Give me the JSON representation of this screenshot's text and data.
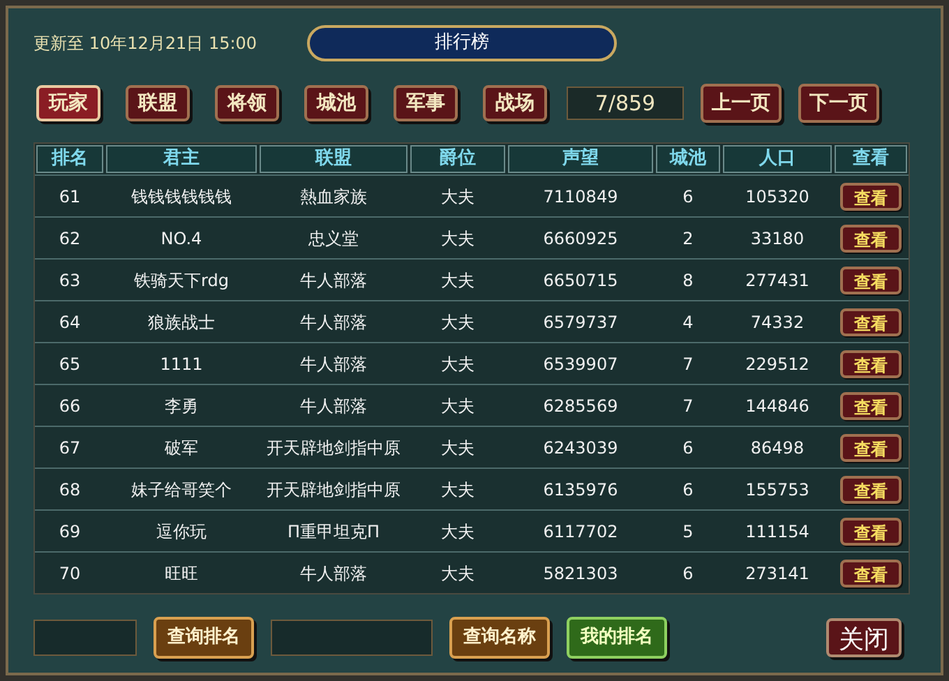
{
  "updated": "更新至 10年12月21日 15:00",
  "title": "排行榜",
  "tabs": [
    {
      "label": "玩家",
      "selected": true
    },
    {
      "label": "联盟",
      "selected": false
    },
    {
      "label": "将领",
      "selected": false
    },
    {
      "label": "城池",
      "selected": false
    },
    {
      "label": "军事",
      "selected": false
    },
    {
      "label": "战场",
      "selected": false
    }
  ],
  "page_indicator": "7/859",
  "nav_buttons": [
    "上一页",
    "下一页"
  ],
  "table": {
    "columns": [
      "排名",
      "君主",
      "联盟",
      "爵位",
      "声望",
      "城池",
      "人口",
      "查看"
    ],
    "rows": [
      {
        "cells": [
          "61",
          "钱钱钱钱钱钱",
          "熱血家族",
          "大夫",
          "7110849",
          "6",
          "105320"
        ],
        "action": "查看"
      },
      {
        "cells": [
          "62",
          "NO.4",
          "忠义堂",
          "大夫",
          "6660925",
          "2",
          "33180"
        ],
        "action": "查看"
      },
      {
        "cells": [
          "63",
          "铁骑天下rdg",
          "牛人部落",
          "大夫",
          "6650715",
          "8",
          "277431"
        ],
        "action": "查看"
      },
      {
        "cells": [
          "64",
          "狼族战士",
          "牛人部落",
          "大夫",
          "6579737",
          "4",
          "74332"
        ],
        "action": "查看"
      },
      {
        "cells": [
          "65",
          "1111",
          "牛人部落",
          "大夫",
          "6539907",
          "7",
          "229512"
        ],
        "action": "查看"
      },
      {
        "cells": [
          "66",
          "李勇",
          "牛人部落",
          "大夫",
          "6285569",
          "7",
          "144846"
        ],
        "action": "查看"
      },
      {
        "cells": [
          "67",
          "破军",
          "开天辟地剑指中原",
          "大夫",
          "6243039",
          "6",
          "86498"
        ],
        "action": "查看"
      },
      {
        "cells": [
          "68",
          "妹子给哥笑个",
          "开天辟地剑指中原",
          "大夫",
          "6135976",
          "6",
          "155753"
        ],
        "action": "查看"
      },
      {
        "cells": [
          "69",
          "逗你玩",
          "Π重甲坦克Π",
          "大夫",
          "6117702",
          "5",
          "111154"
        ],
        "action": "查看"
      },
      {
        "cells": [
          "70",
          "旺旺",
          "牛人部落",
          "大夫",
          "5821303",
          "6",
          "273141"
        ],
        "action": "查看"
      }
    ]
  },
  "bottom": [
    {
      "kind": "field"
    },
    {
      "kind": "gold",
      "label": "查询排名"
    },
    {
      "kind": "field"
    },
    {
      "kind": "gold",
      "label": "查询名称"
    },
    {
      "kind": "green",
      "label": "我的排名"
    },
    {
      "kind": "close",
      "label": "关闭"
    }
  ]
}
